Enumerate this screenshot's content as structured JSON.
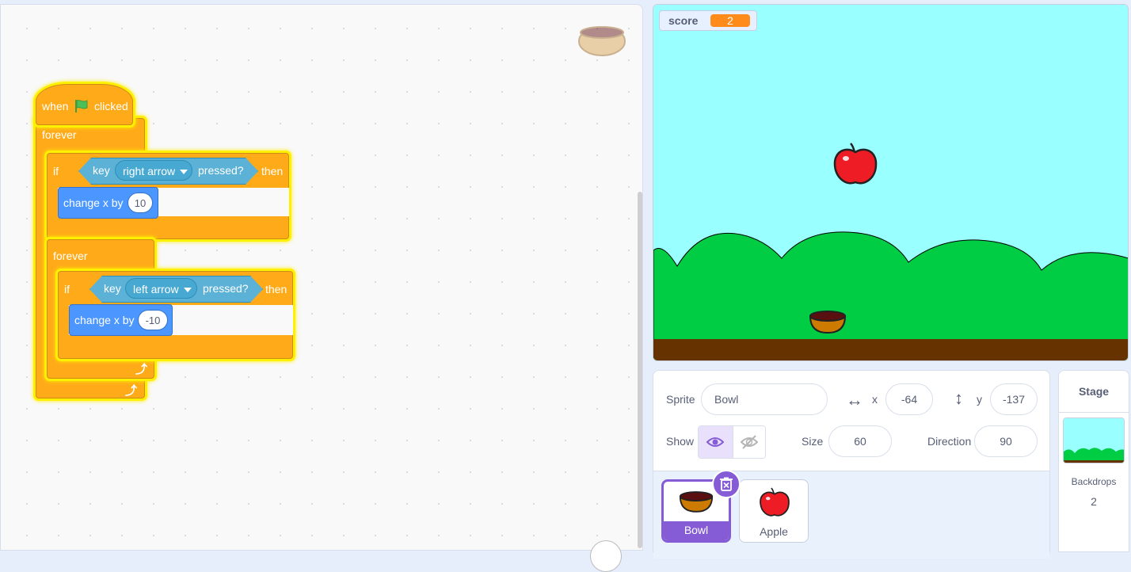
{
  "colors": {
    "event": "#ffab19",
    "control": "#ffab19",
    "motion": "#4c97ff",
    "sensing": "#5cb1d6",
    "glow": "#ffef00",
    "sky": "#99ffff",
    "grass": "#00cc44",
    "ground": "#663300",
    "selection": "#855cd6"
  },
  "script": {
    "hat": {
      "when": "when",
      "flag_icon": "green-flag-icon",
      "clicked": "clicked"
    },
    "forever1": "forever",
    "if1": {
      "if": "if",
      "key": "key",
      "key_option": "right arrow",
      "pressed": "pressed?",
      "then": "then"
    },
    "change1": {
      "label": "change x by",
      "value": "10"
    },
    "forever2": "forever",
    "if2": {
      "if": "if",
      "key": "key",
      "key_option": "left arrow",
      "pressed": "pressed?",
      "then": "then"
    },
    "change2": {
      "label": "change x by",
      "value": "-10"
    }
  },
  "stage": {
    "monitor": {
      "label": "score",
      "value": "2"
    }
  },
  "sprite_info": {
    "sprite_label": "Sprite",
    "sprite_name": "Bowl",
    "x_label": "x",
    "x_value": "-64",
    "y_label": "y",
    "y_value": "-137",
    "show_label": "Show",
    "size_label": "Size",
    "size_value": "60",
    "direction_label": "Direction",
    "direction_value": "90"
  },
  "sprites": [
    {
      "name": "Bowl",
      "selected": true
    },
    {
      "name": "Apple",
      "selected": false
    }
  ],
  "stage_selector": {
    "title": "Stage",
    "backdrops_label": "Backdrops",
    "backdrops_count": "2"
  }
}
